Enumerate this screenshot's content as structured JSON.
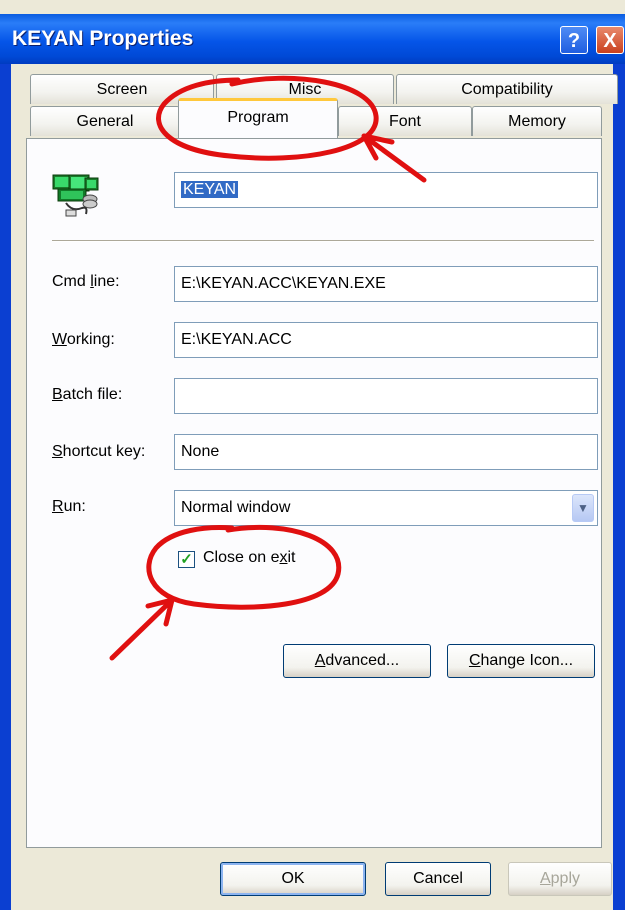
{
  "window": {
    "title": "KEYAN Properties"
  },
  "title_buttons": {
    "help": "?",
    "close": "X"
  },
  "tabs": {
    "row1": [
      "Screen",
      "Misc",
      "Compatibility"
    ],
    "row2": [
      "General",
      "Program",
      "Font",
      "Memory"
    ],
    "selected": "Program"
  },
  "program": {
    "name": "KEYAN",
    "icon": "ms-dos-program-icon",
    "cmd_line": {
      "label_pre": "Cmd ",
      "label_u": "l",
      "label_post": "ine:",
      "value": "E:\\KEYAN.ACC\\KEYAN.EXE"
    },
    "working": {
      "label_u": "W",
      "label_post": "orking:",
      "value": "E:\\KEYAN.ACC"
    },
    "batch": {
      "label_u": "B",
      "label_post": "atch file:",
      "value": ""
    },
    "shortcut": {
      "label_u": "S",
      "label_post": "hortcut key:",
      "value": "None"
    },
    "run": {
      "label_u": "R",
      "label_post": "un:",
      "value": "Normal window"
    },
    "close_on_exit": {
      "label_pre": "Close on e",
      "label_u": "x",
      "label_post": "it",
      "checked": true
    }
  },
  "buttons": {
    "advanced": {
      "label_u": "A",
      "label_post": "dvanced..."
    },
    "change_icon": {
      "label_u": "C",
      "label_post": "hange Icon..."
    },
    "ok": "OK",
    "cancel": "Cancel",
    "apply": {
      "label_u": "A",
      "label_post": "pply",
      "enabled": false
    }
  },
  "annotations": {
    "color": "#e01010"
  },
  "colors": {
    "titlebar": "#0a5ce0",
    "selection": "#316ac5",
    "tab_highlight": "#ffc83c"
  }
}
